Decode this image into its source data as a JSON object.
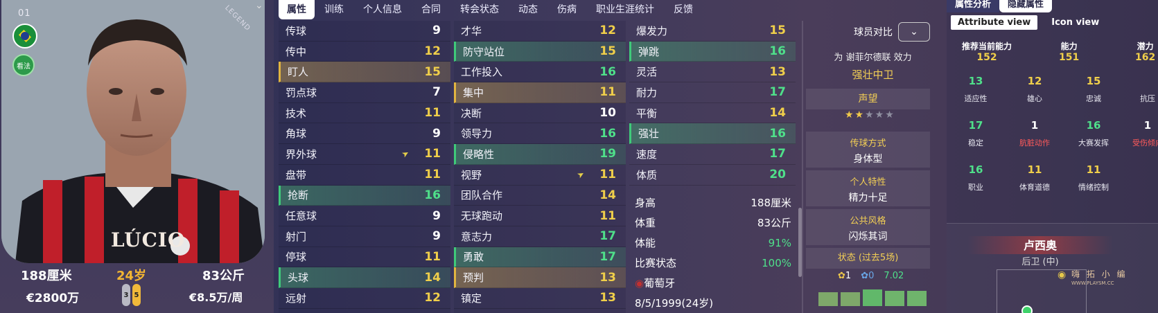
{
  "player": {
    "number": "01",
    "brand_mark": "LEGEND",
    "name_on_shirt": "LÚCIO",
    "role_badge": "看法",
    "height": "188厘米",
    "age": "24岁",
    "weight": "83公斤",
    "value": "€2800万",
    "wage": "€8.5万/周",
    "left_foot": "3",
    "right_foot": "5"
  },
  "tabs": [
    "属性",
    "训练",
    "个人信息",
    "合同",
    "转会状态",
    "动态",
    "伤病",
    "职业生涯统计",
    "反馈"
  ],
  "attr_col1": [
    {
      "n": "传球",
      "v": "9",
      "c": "w",
      "h": ""
    },
    {
      "n": "传中",
      "v": "12",
      "c": "y",
      "h": ""
    },
    {
      "n": "盯人",
      "v": "15",
      "c": "y",
      "h": "hy bl-y"
    },
    {
      "n": "罚点球",
      "v": "7",
      "c": "w",
      "h": ""
    },
    {
      "n": "技术",
      "v": "11",
      "c": "y",
      "h": ""
    },
    {
      "n": "角球",
      "v": "9",
      "c": "w",
      "h": ""
    },
    {
      "n": "界外球",
      "v": "11",
      "c": "y",
      "h": "",
      "arrow": true
    },
    {
      "n": "盘带",
      "v": "11",
      "c": "y",
      "h": ""
    },
    {
      "n": "抢断",
      "v": "16",
      "c": "g",
      "h": "hg bl-g"
    },
    {
      "n": "任意球",
      "v": "9",
      "c": "w",
      "h": ""
    },
    {
      "n": "射门",
      "v": "9",
      "c": "w",
      "h": ""
    },
    {
      "n": "停球",
      "v": "11",
      "c": "y",
      "h": ""
    },
    {
      "n": "头球",
      "v": "14",
      "c": "y",
      "h": "hg bl-g"
    },
    {
      "n": "远射",
      "v": "12",
      "c": "y",
      "h": ""
    }
  ],
  "attr_col2": [
    {
      "n": "才华",
      "v": "12",
      "c": "y",
      "h": ""
    },
    {
      "n": "防守站位",
      "v": "15",
      "c": "y",
      "h": "hg bl-g"
    },
    {
      "n": "工作投入",
      "v": "16",
      "c": "g",
      "h": ""
    },
    {
      "n": "集中",
      "v": "11",
      "c": "y",
      "h": "hy bl-y"
    },
    {
      "n": "决断",
      "v": "10",
      "c": "w",
      "h": ""
    },
    {
      "n": "领导力",
      "v": "16",
      "c": "g",
      "h": ""
    },
    {
      "n": "侵略性",
      "v": "19",
      "c": "g",
      "h": "hg bl-g"
    },
    {
      "n": "视野",
      "v": "11",
      "c": "y",
      "h": "",
      "arrow": true
    },
    {
      "n": "团队合作",
      "v": "14",
      "c": "y",
      "h": ""
    },
    {
      "n": "无球跑动",
      "v": "11",
      "c": "y",
      "h": ""
    },
    {
      "n": "意志力",
      "v": "17",
      "c": "g",
      "h": ""
    },
    {
      "n": "勇敢",
      "v": "17",
      "c": "g",
      "h": "hg bl-g"
    },
    {
      "n": "预判",
      "v": "13",
      "c": "y",
      "h": "hy bl-y"
    },
    {
      "n": "镇定",
      "v": "13",
      "c": "y",
      "h": ""
    }
  ],
  "attr_col3": [
    {
      "n": "爆发力",
      "v": "15",
      "c": "y",
      "h": ""
    },
    {
      "n": "弹跳",
      "v": "16",
      "c": "g",
      "h": "hg bl-g"
    },
    {
      "n": "灵活",
      "v": "13",
      "c": "y",
      "h": ""
    },
    {
      "n": "耐力",
      "v": "17",
      "c": "g",
      "h": ""
    },
    {
      "n": "平衡",
      "v": "14",
      "c": "y",
      "h": ""
    },
    {
      "n": "强壮",
      "v": "16",
      "c": "g",
      "h": "hg bl-g"
    },
    {
      "n": "速度",
      "v": "17",
      "c": "g",
      "h": ""
    },
    {
      "n": "体质",
      "v": "20",
      "c": "g",
      "h": ""
    }
  ],
  "info": [
    {
      "k": "身高",
      "v": "188厘米",
      "c": "w"
    },
    {
      "k": "体重",
      "v": "83公斤",
      "c": "w"
    },
    {
      "k": "体能",
      "v": "91%",
      "c": "g"
    },
    {
      "k": "比赛状态",
      "v": "100%",
      "c": "g"
    },
    {
      "k": "葡萄牙",
      "v": "",
      "c": "w"
    },
    {
      "k": "8/5/1999(24岁)",
      "v": "",
      "c": "w"
    }
  ],
  "mid": {
    "compare_label": "球员对比",
    "playing_for": "为 谢菲尔德联 效力",
    "role": "强壮中卫",
    "reputation_label": "声望",
    "passing_style_label": "传球方式",
    "passing_style": "身体型",
    "trait_label": "个人特性",
    "trait": "精力十足",
    "media_label": "公共风格",
    "media": "闪烁其词",
    "form_label": "状态 (过去5场)",
    "goals": "1",
    "assists": "0",
    "rating": "7.02"
  },
  "right": {
    "tab_analysis": "属性分析",
    "tab_hidden": "隐藏属性",
    "view_attr": "Attribute view",
    "view_icon": "Icon view",
    "rec_label": "推荐当前能力",
    "rec_val": "152",
    "ability_label": "能力",
    "ability_val": "151",
    "potential_label": "潜力",
    "potential_val": "162",
    "hidden": [
      {
        "v": "13",
        "l": "适应性",
        "c": "g",
        "lc": "w"
      },
      {
        "v": "12",
        "l": "雄心",
        "c": "y",
        "lc": "w"
      },
      {
        "v": "15",
        "l": "忠诚",
        "c": "y",
        "lc": "w"
      },
      {
        "v": "",
        "l": "抗压",
        "c": "y",
        "lc": "w"
      },
      {
        "v": "17",
        "l": "稳定",
        "c": "g",
        "lc": "w"
      },
      {
        "v": "1",
        "l": "肮脏动作",
        "c": "w",
        "lc": "r"
      },
      {
        "v": "16",
        "l": "大赛发挥",
        "c": "g",
        "lc": "w"
      },
      {
        "v": "1",
        "l": "受伤倾向",
        "c": "w",
        "lc": "r"
      },
      {
        "v": "16",
        "l": "职业",
        "c": "g",
        "lc": "w"
      },
      {
        "v": "11",
        "l": "体育道德",
        "c": "y",
        "lc": "w"
      },
      {
        "v": "11",
        "l": "情绪控制",
        "c": "y",
        "lc": "w"
      }
    ],
    "pos_name": "卢西奥",
    "pos_role": "后卫 (中)"
  },
  "watermark": "嗨 拓 小 编",
  "watermark_url": "WWW.PLAYSM.CC"
}
